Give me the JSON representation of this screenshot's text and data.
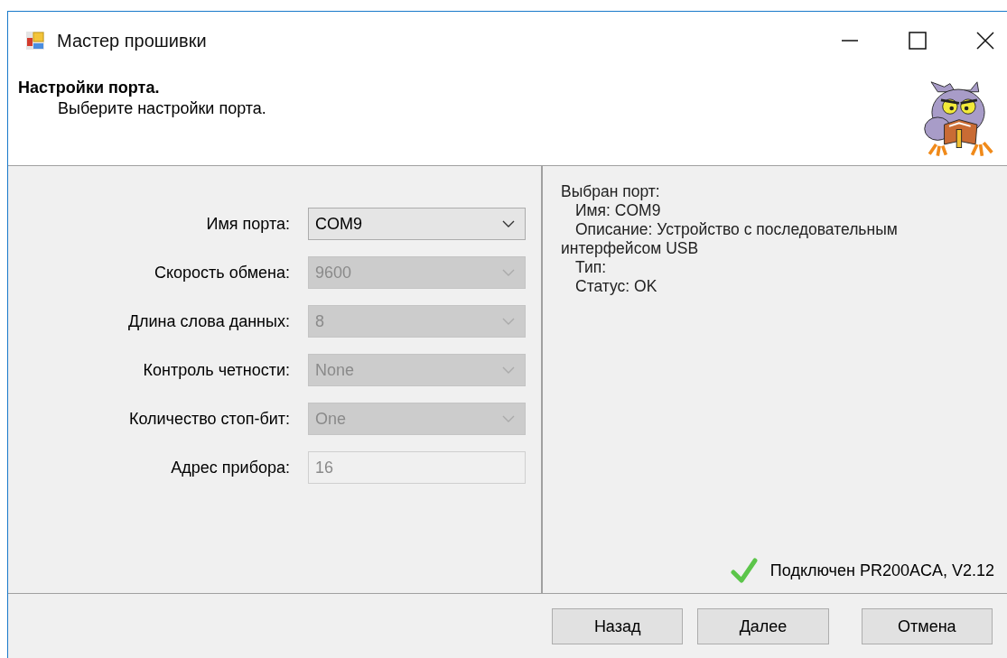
{
  "window": {
    "title": "Мастер прошивки"
  },
  "header": {
    "title": "Настройки порта.",
    "subtitle": "Выберите настройки порта."
  },
  "fields": [
    {
      "label": "Имя порта:",
      "kind": "combo",
      "value": "COM9",
      "disabled": false
    },
    {
      "label": "Скорость обмена:",
      "kind": "combo",
      "value": "9600",
      "disabled": true
    },
    {
      "label": "Длина слова данных:",
      "kind": "combo",
      "value": "8",
      "disabled": true
    },
    {
      "label": "Контроль четности:",
      "kind": "combo",
      "value": "None",
      "disabled": true
    },
    {
      "label": "Количество стоп-бит:",
      "kind": "combo",
      "value": "One",
      "disabled": true
    },
    {
      "label": "Адрес прибора:",
      "kind": "text",
      "value": "16",
      "disabled": true
    }
  ],
  "details": [
    {
      "text": "Выбран порт:",
      "indented": false
    },
    {
      "text": "Имя: COM9",
      "indented": true
    },
    {
      "text": "Описание: Устройство с последовательным интерфейсом USB",
      "indented": true
    },
    {
      "text": "Тип:",
      "indented": true
    },
    {
      "text": "Статус: OK",
      "indented": true
    }
  ],
  "status": {
    "text": "Подключен PR200ACA, V2.12"
  },
  "buttons": [
    "Назад",
    "Далее",
    "Отмена"
  ]
}
